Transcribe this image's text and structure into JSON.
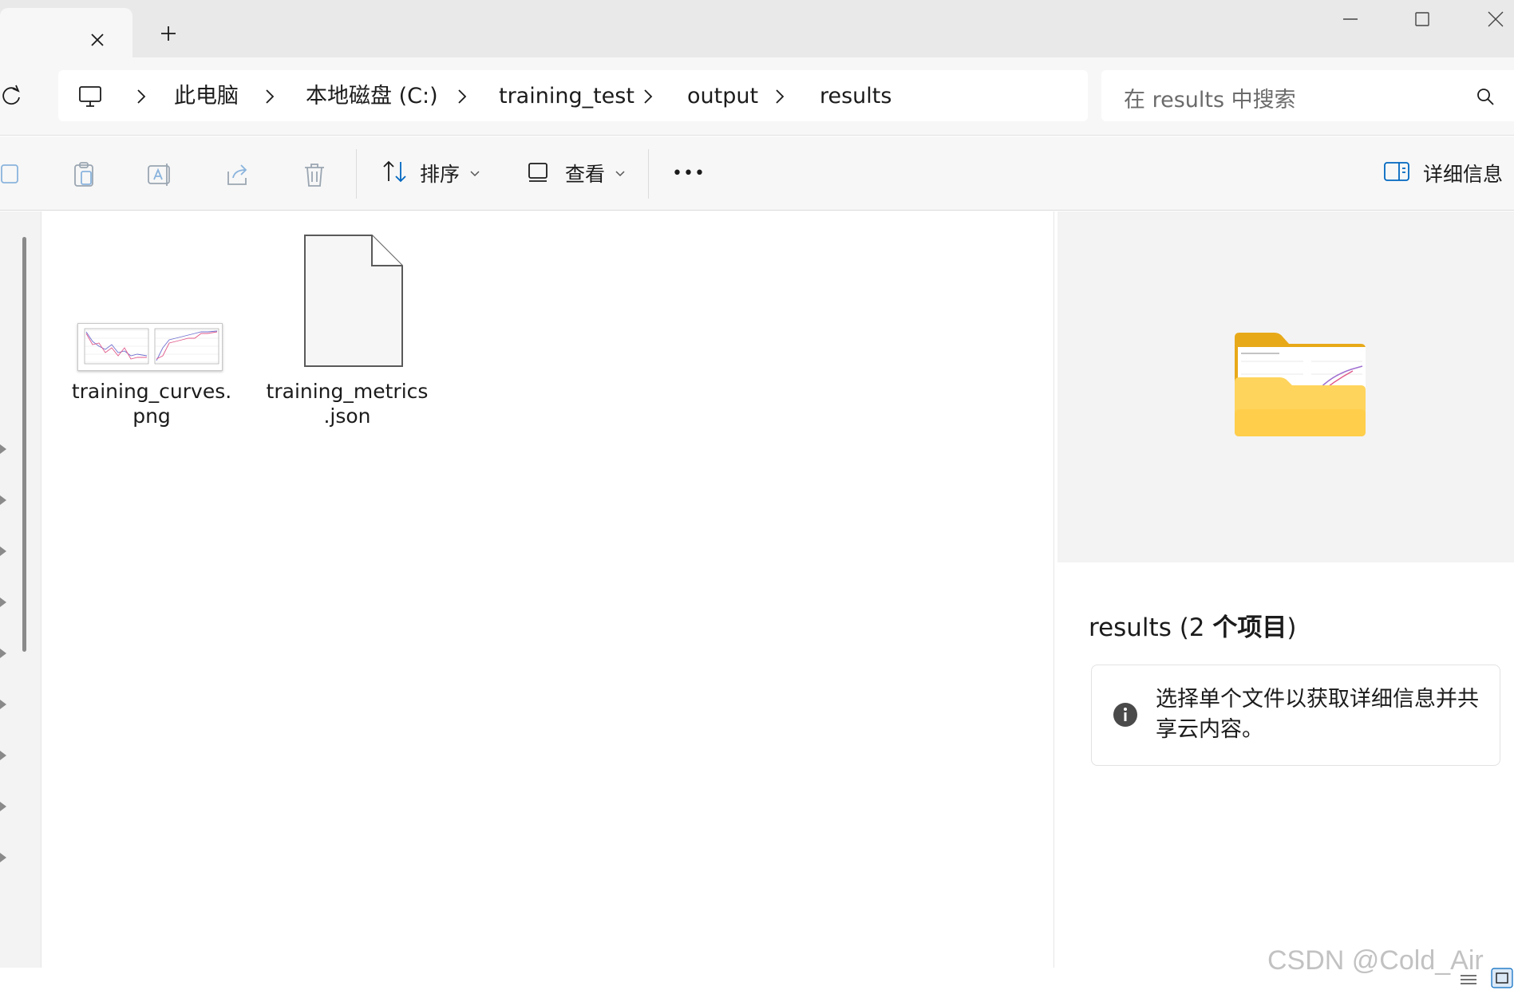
{
  "tabs": {
    "close_icon": "close-icon",
    "new_tab_icon": "plus-icon"
  },
  "window_controls": [
    "minimize-icon",
    "maximize-icon",
    "close-icon"
  ],
  "address": {
    "breadcrumb": [
      "此电脑",
      "本地磁盘 (C:)",
      "training_test",
      "output",
      "results"
    ]
  },
  "search": {
    "placeholder": "在 results 中搜索"
  },
  "toolbar": {
    "sort_label": "排序",
    "view_label": "查看",
    "more_label": "•••",
    "details_label": "详细信息"
  },
  "files": [
    {
      "name": "training_curves.png",
      "name_line1": "training_curves.",
      "name_line2": "png",
      "kind": "image-thumbnail"
    },
    {
      "name": "training_metrics.json",
      "name_line1": "training_metrics",
      "name_line2": ".json",
      "kind": "generic-file"
    }
  ],
  "details_pane": {
    "title_prefix": "results (2 ",
    "title_bold": "个项目",
    "title_suffix": ")",
    "info_text": "选择单个文件以获取详细信息并共享云内容。"
  },
  "watermark": "CSDN @Cold_Air",
  "colors": {
    "accent": "#0067c0",
    "folder_yellow": "#f8c43a",
    "folder_light": "#ffd86a"
  }
}
